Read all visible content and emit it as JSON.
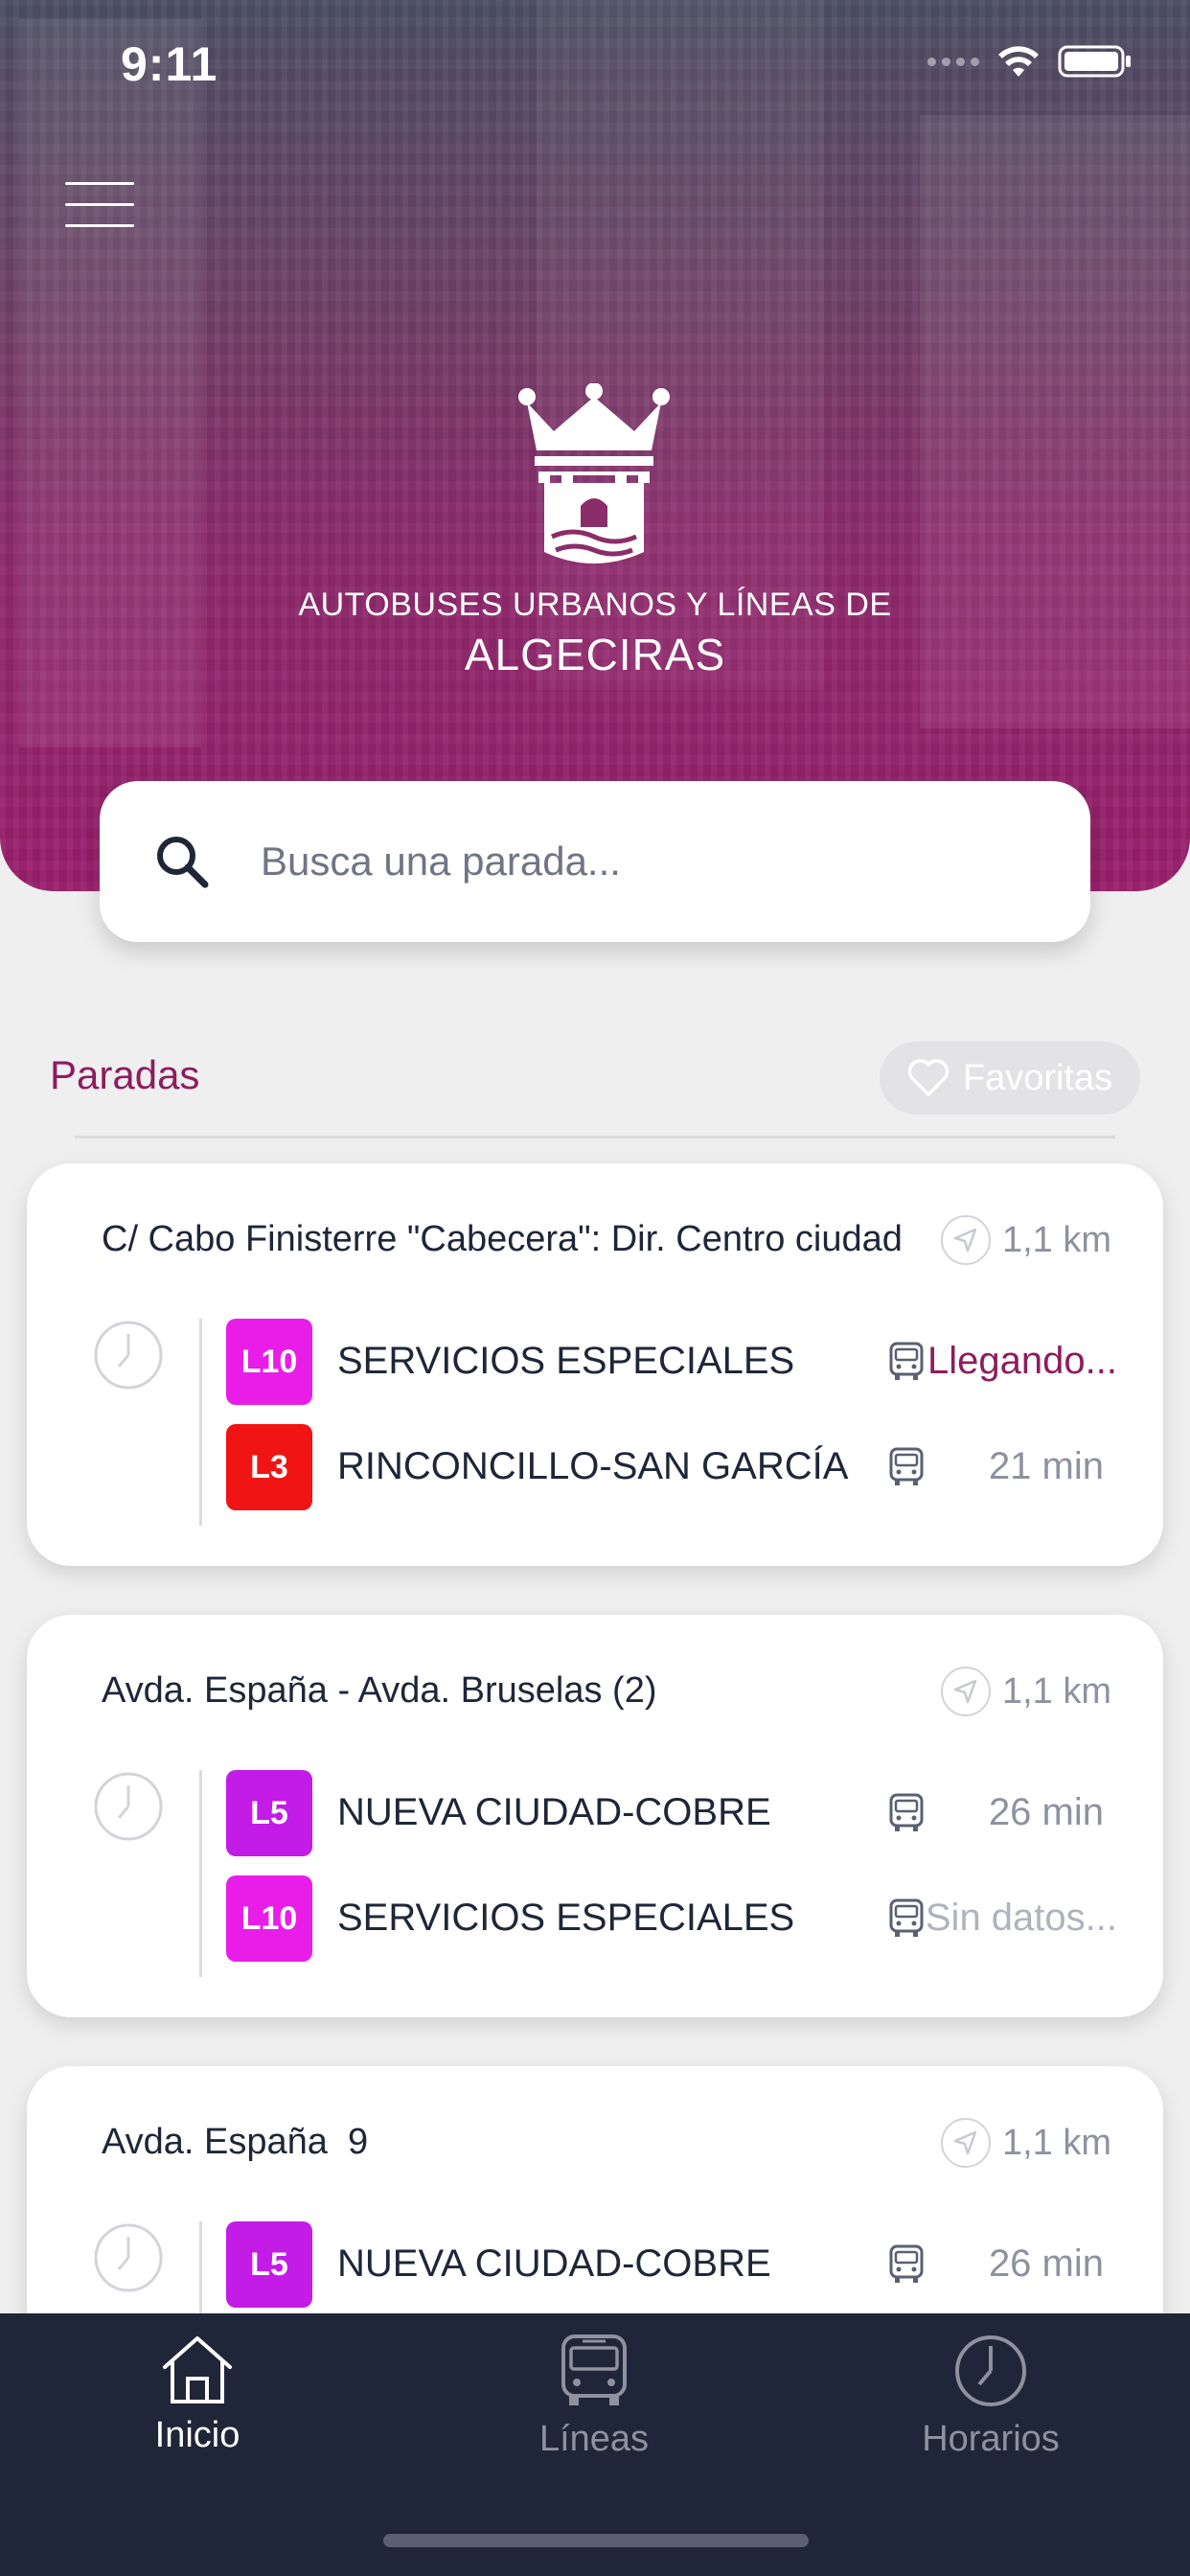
{
  "status_bar": {
    "time": "9:11"
  },
  "header": {
    "brand_line1": "AUTOBUSES URBANOS Y LÍNEAS DE",
    "brand_line2": "ALGECIRAS",
    "menu_icon": "hamburger-menu-icon",
    "logo_icon": "crown-castle-logo"
  },
  "search": {
    "placeholder": "Busca una parada...",
    "value": ""
  },
  "section": {
    "title": "Paradas",
    "favorites_label": "Favoritas"
  },
  "colors": {
    "brand": "#8c1d5e",
    "tabbar": "#1f2638",
    "L10": "#e81ee8",
    "L3": "#f01414",
    "L5": "#c21ce6"
  },
  "stops": [
    {
      "name": "C/ Cabo Finisterre \"Cabecera\": Dir. Centro ciudad",
      "distance": "1,1 km",
      "lines": [
        {
          "code": "L10",
          "name": "SERVICIOS ESPECIALES",
          "eta": "Llegando...",
          "status": "arriving"
        },
        {
          "code": "L3",
          "name": "RINCONCILLO-SAN GARCÍA",
          "eta": "21 min",
          "status": "normal"
        }
      ]
    },
    {
      "name": "Avda. España - Avda. Bruselas (2)",
      "distance": "1,1 km",
      "lines": [
        {
          "code": "L5",
          "name": "NUEVA CIUDAD-COBRE",
          "eta": "26 min",
          "status": "normal"
        },
        {
          "code": "L10",
          "name": "SERVICIOS ESPECIALES",
          "eta": "Sin datos...",
          "status": "nodata"
        }
      ]
    },
    {
      "name": "Avda. España  9",
      "distance": "1,1 km",
      "lines": [
        {
          "code": "L5",
          "name": "NUEVA CIUDAD-COBRE",
          "eta": "26 min",
          "status": "normal"
        }
      ]
    }
  ],
  "tabs": [
    {
      "label": "Inicio",
      "icon": "home-icon",
      "active": true
    },
    {
      "label": "Líneas",
      "icon": "bus-icon",
      "active": false
    },
    {
      "label": "Horarios",
      "icon": "clock-icon",
      "active": false
    }
  ]
}
